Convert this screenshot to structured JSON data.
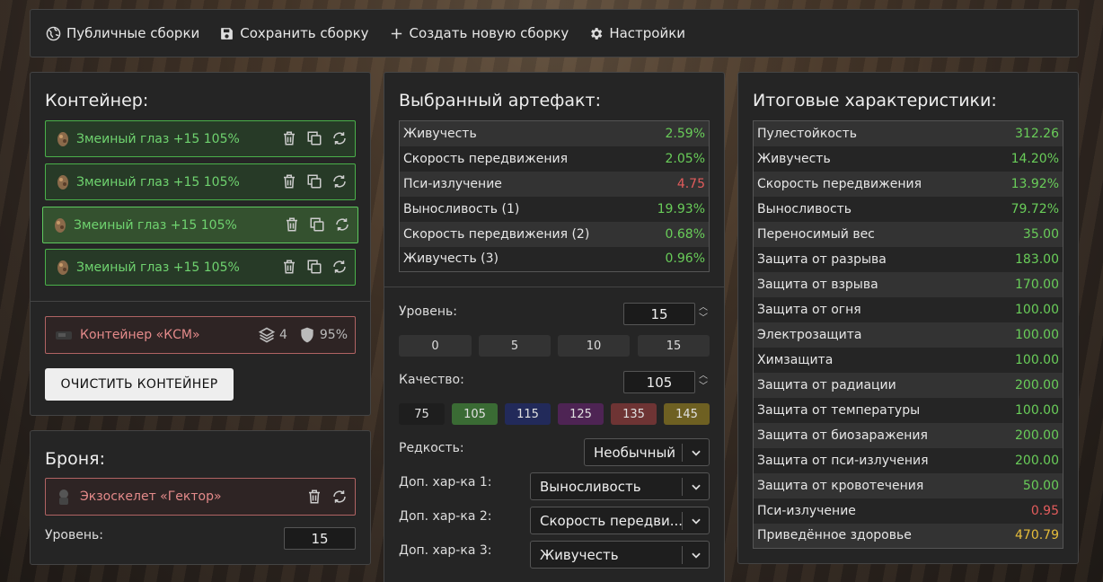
{
  "topbar": {
    "public_builds": "Публичные сборки",
    "save_build": "Сохранить сборку",
    "new_build": "Создать новую сборку",
    "settings": "Настройки"
  },
  "container": {
    "title": "Контейнер:",
    "artifacts": [
      {
        "name": "Змеиный глаз +15 105%"
      },
      {
        "name": "Змеиный глаз +15 105%"
      },
      {
        "name": "Змеиный глаз +15 105%"
      },
      {
        "name": "Змеиный глаз +15 105%"
      }
    ],
    "item": {
      "name": "Контейнер «КСМ»",
      "slots": "4",
      "protection": "95%"
    },
    "clear_button": "ОЧИСТИТЬ КОНТЕЙНЕР"
  },
  "armor": {
    "title": "Броня:",
    "item": {
      "name": "Экзоскелет «Гектор»"
    },
    "level_label": "Уровень:",
    "level_value": "15"
  },
  "artifact": {
    "title": "Выбранный артефакт:",
    "stats": [
      {
        "label": "Живучесть",
        "value": "2.59%",
        "color": "g"
      },
      {
        "label": "Скорость передвижения",
        "value": "2.05%",
        "color": "g"
      },
      {
        "label": "Пси-излучение",
        "value": "4.75",
        "color": "r"
      },
      {
        "label": "Выносливость (1)",
        "value": "19.93%",
        "color": "g"
      },
      {
        "label": "Скорость передвижения (2)",
        "value": "0.68%",
        "color": "g"
      },
      {
        "label": "Живучесть (3)",
        "value": "0.96%",
        "color": "g"
      }
    ],
    "level_label": "Уровень:",
    "level_value": "15",
    "level_presets": [
      "0",
      "5",
      "10",
      "15"
    ],
    "quality_label": "Качество:",
    "quality_value": "105",
    "quality_presets": [
      {
        "label": "75",
        "color": "#1e1e1e"
      },
      {
        "label": "105",
        "color": "#3a6b34"
      },
      {
        "label": "115",
        "color": "#222a5a"
      },
      {
        "label": "125",
        "color": "#4e2454"
      },
      {
        "label": "135",
        "color": "#6e3434"
      },
      {
        "label": "145",
        "color": "#6e6022"
      }
    ],
    "rarity_label": "Редкость:",
    "rarity_value": "Необычный",
    "extra1_label": "Доп. хар-ка 1:",
    "extra1_value": "Выносливость",
    "extra2_label": "Доп. хар-ка 2:",
    "extra2_value": "Скорость передви...",
    "extra3_label": "Доп. хар-ка 3:",
    "extra3_value": "Живучесть"
  },
  "totals": {
    "title": "Итоговые характеристики:",
    "stats": [
      {
        "label": "Пулестойкость",
        "value": "312.26",
        "color": "g"
      },
      {
        "label": "Живучесть",
        "value": "14.20%",
        "color": "g"
      },
      {
        "label": "Скорость передвижения",
        "value": "13.92%",
        "color": "g"
      },
      {
        "label": "Выносливость",
        "value": "79.72%",
        "color": "g"
      },
      {
        "label": "Переносимый вес",
        "value": "35.00",
        "color": "g"
      },
      {
        "label": "Защита от разрыва",
        "value": "183.00",
        "color": "g"
      },
      {
        "label": "Защита от взрыва",
        "value": "170.00",
        "color": "g"
      },
      {
        "label": "Защита от огня",
        "value": "100.00",
        "color": "g"
      },
      {
        "label": "Электрозащита",
        "value": "100.00",
        "color": "g"
      },
      {
        "label": "Химзащита",
        "value": "100.00",
        "color": "g"
      },
      {
        "label": "Защита от радиации",
        "value": "200.00",
        "color": "g"
      },
      {
        "label": "Защита от температуры",
        "value": "100.00",
        "color": "g"
      },
      {
        "label": "Защита от биозаражения",
        "value": "200.00",
        "color": "g"
      },
      {
        "label": "Защита от пси-излучения",
        "value": "200.00",
        "color": "g"
      },
      {
        "label": "Защита от кровотечения",
        "value": "50.00",
        "color": "g"
      },
      {
        "label": "Пси-излучение",
        "value": "0.95",
        "color": "r"
      },
      {
        "label": "Приведённое здоровье",
        "value": "470.79",
        "color": "y"
      }
    ]
  }
}
